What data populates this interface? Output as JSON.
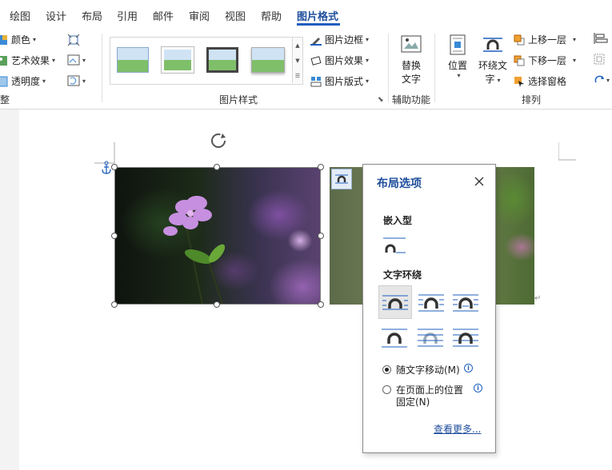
{
  "tabs": [
    {
      "label": "绘图"
    },
    {
      "label": "设计"
    },
    {
      "label": "布局"
    },
    {
      "label": "引用"
    },
    {
      "label": "邮件"
    },
    {
      "label": "审阅"
    },
    {
      "label": "视图"
    },
    {
      "label": "帮助"
    },
    {
      "label": "图片格式",
      "active": true
    }
  ],
  "ribbon": {
    "adjust": {
      "color_label": "颜色",
      "artistic_effects_label": "艺术效果",
      "transparency_label": "透明度",
      "group_label_partial": "整"
    },
    "styles": {
      "group_label": "图片样式",
      "border_label": "图片边框",
      "effects_label": "图片效果",
      "layout_label": "图片版式"
    },
    "accessibility": {
      "alt_text_line1": "替换",
      "alt_text_line2": "文字",
      "group_label": "辅助功能"
    },
    "arrange": {
      "position_label": "位置",
      "wrap_text_line1": "环绕文",
      "wrap_text_line2": "字",
      "bring_forward_label": "上移一层",
      "send_backward_label": "下移一层",
      "selection_pane_label": "选择窗格",
      "group_label": "排列"
    }
  },
  "popup": {
    "title": "布局选项",
    "inline_section": "嵌入型",
    "wrap_section": "文字环绕",
    "move_with_text_label": "随文字移动(M)",
    "fix_position_line1": "在页面上的位置",
    "fix_position_line2": "固定(N)",
    "see_more_label": "查看更多...",
    "selected_radio": "move_with_text"
  },
  "colors": {
    "accent": "#1f5fbf",
    "active_tab": "#1f4e9c"
  }
}
